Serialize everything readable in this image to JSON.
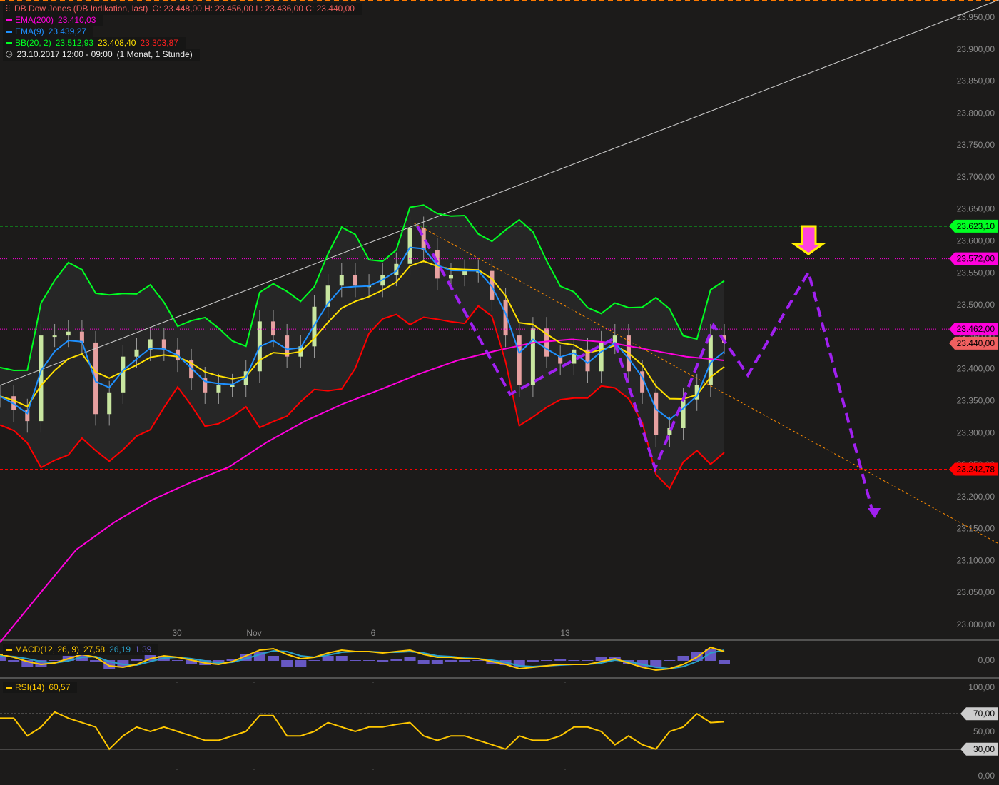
{
  "legend": {
    "instrument": "DB Dow Jones (DB Indikation, last)",
    "ohlc": "O: 23.448,00  H: 23.456,00  L: 23.436,00  C: 23.440,00",
    "ema200_label": "EMA(200)",
    "ema200_value": "23.410,03",
    "ema9_label": "EMA(9)",
    "ema9_value": "23.439,27",
    "bb_label": "BB(20, 2)",
    "bb_upper": "23.512,93",
    "bb_mid": "23.408,40",
    "bb_lower": "23.303,87",
    "range": "23.10.2017 12:00 - 09:00",
    "period": "(1 Monat, 1 Stunde)",
    "macd_label": "MACD(12, 26, 9)",
    "macd_value": "27,58",
    "macd_signal": "26,19",
    "macd_hist": "1,39",
    "rsi_label": "RSI(14)",
    "rsi_value": "60,57"
  },
  "colors": {
    "background": "#1c1b1a",
    "ema200": "#ff00dd",
    "ema9": "#1e90ff",
    "bb_upper": "#00ff22",
    "bb_mid": "#ffe000",
    "bb_lower": "#ff0000",
    "drawing": "#a020f0",
    "arrow": "#ff44dd",
    "arrow_outline": "#ffee00",
    "candle_up": "#c8e6a0",
    "candle_down": "#e6a0a0",
    "macd": "#ffc800",
    "signal": "#2aa0c8",
    "hist": "#7b68ee",
    "rsi": "#ffc800"
  },
  "chart_data": {
    "type": "candlestick",
    "x_ticks": [
      "30",
      "Nov",
      "6",
      "13"
    ],
    "y_ticks": [
      23000,
      23050,
      23100,
      23150,
      23200,
      23250,
      23300,
      23350,
      23400,
      23450,
      23500,
      23550,
      23600,
      23650,
      23700,
      23750,
      23800,
      23850,
      23900,
      23950
    ],
    "y_tick_labels": [
      "23.000,00",
      "23.050,00",
      "23.100,00",
      "23.150,00",
      "23.200,00",
      "23.250,00",
      "23.300,00",
      "23.350,00",
      "23.400,00",
      "23.450,00",
      "23.500,00",
      "23.550,00",
      "23.600,00",
      "23.650,00",
      "23.700,00",
      "23.750,00",
      "23.800,00",
      "23.850,00",
      "23.900,00",
      "23.950,00"
    ],
    "ylim": [
      22975,
      23975
    ],
    "close": [
      23357,
      23335,
      23318,
      23452,
      23452,
      23458,
      23441,
      23329,
      23363,
      23419,
      23430,
      23446,
      23430,
      23413,
      23385,
      23363,
      23374,
      23374,
      23396,
      23474,
      23452,
      23419,
      23435,
      23497,
      23530,
      23547,
      23530,
      23530,
      23547,
      23564,
      23620,
      23586,
      23541,
      23547,
      23553,
      23553,
      23508,
      23452,
      23374,
      23463,
      23419,
      23408,
      23430,
      23396,
      23441,
      23452,
      23396,
      23363,
      23296,
      23307,
      23352,
      23374,
      23452,
      23441
    ],
    "ema200": [
      22972,
      23045,
      23117,
      23160,
      23195,
      23222,
      23246,
      23285,
      23318,
      23345,
      23368,
      23392,
      23413,
      23428,
      23441,
      23446,
      23441,
      23430,
      23419,
      23413
    ],
    "levels": [
      {
        "value": 23623.1,
        "label": "23.623,10",
        "color": "#00ff22"
      },
      {
        "value": 23572.0,
        "label": "23.572,00",
        "color": "#ff00dd"
      },
      {
        "value": 23462.0,
        "label": "23.462,00",
        "color": "#ff00dd"
      },
      {
        "value": 23440.0,
        "label": "23.440,00",
        "color": "#f06060",
        "last": true
      },
      {
        "value": 23242.78,
        "label": "23.242,78",
        "color": "#ff0000"
      }
    ],
    "trendlines": [
      {
        "from": 23374,
        "to": 23977,
        "color": "#cccccc"
      },
      {
        "from": 23628,
        "to": 23126,
        "color": "#ff8c00"
      }
    ],
    "projection_path": [
      23623,
      23360,
      23447,
      23244,
      23468,
      23390,
      23551,
      23167
    ],
    "macd": {
      "zero_label": "0,00",
      "macd": [
        8,
        4,
        -2,
        -6,
        -4,
        2,
        8,
        4,
        -8,
        -10,
        -6,
        2,
        6,
        4,
        0,
        -4,
        -6,
        -2,
        6,
        14,
        16,
        8,
        2,
        4,
        10,
        14,
        12,
        12,
        10,
        12,
        14,
        8,
        4,
        4,
        2,
        2,
        -2,
        -6,
        -12,
        -10,
        -8,
        -6,
        -6,
        -6,
        -2,
        2,
        -4,
        -10,
        -14,
        -12,
        -6,
        4,
        18,
        12
      ],
      "signal": [
        6,
        5,
        2,
        -2,
        -4,
        -1,
        4,
        5,
        -2,
        -6,
        -7,
        -2,
        3,
        4,
        2,
        -1,
        -4,
        -3,
        2,
        8,
        13,
        12,
        6,
        4,
        7,
        11,
        12,
        12,
        11,
        11,
        12,
        10,
        6,
        5,
        3,
        2,
        0,
        -3,
        -8,
        -9,
        -8,
        -7,
        -6,
        -6,
        -4,
        0,
        -2,
        -6,
        -10,
        -12,
        -9,
        -2,
        10,
        14
      ]
    },
    "rsi": {
      "ticks": [
        "100,00",
        "70,00",
        "50,00",
        "30,00",
        "0,00"
      ],
      "overbought": 70,
      "oversold": 30,
      "values": [
        65,
        65,
        45,
        55,
        72,
        65,
        60,
        55,
        30,
        45,
        55,
        50,
        55,
        50,
        45,
        40,
        40,
        45,
        50,
        68,
        68,
        45,
        45,
        50,
        60,
        55,
        50,
        55,
        55,
        58,
        60,
        45,
        40,
        45,
        45,
        40,
        35,
        30,
        45,
        40,
        40,
        45,
        55,
        55,
        50,
        35,
        45,
        35,
        30,
        50,
        55,
        70,
        60,
        61
      ]
    }
  }
}
